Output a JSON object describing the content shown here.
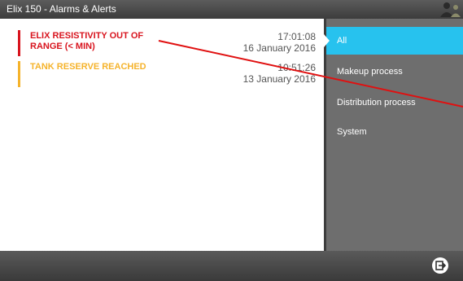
{
  "window": {
    "title": "Elix 150 - Alarms & Alerts"
  },
  "alarms": [
    {
      "message": "ELIX RESISTIVITY OUT OF RANGE (< MIN)",
      "time": "17:01:08",
      "date": "16 January 2016",
      "color": "#d8141e"
    },
    {
      "message": "TANK RESERVE REACHED",
      "time": "10:51:26",
      "date": "13 January 2016",
      "color": "#f5b32b"
    }
  ],
  "sidebar": {
    "items": [
      {
        "label": "All",
        "active": true
      },
      {
        "label": "Makeup process",
        "active": false
      },
      {
        "label": "Distribution process",
        "active": false
      },
      {
        "label": "System",
        "active": false
      }
    ],
    "active_color": "#27c2ee"
  },
  "icons": {
    "user": "user-icon",
    "exit": "exit-icon"
  }
}
